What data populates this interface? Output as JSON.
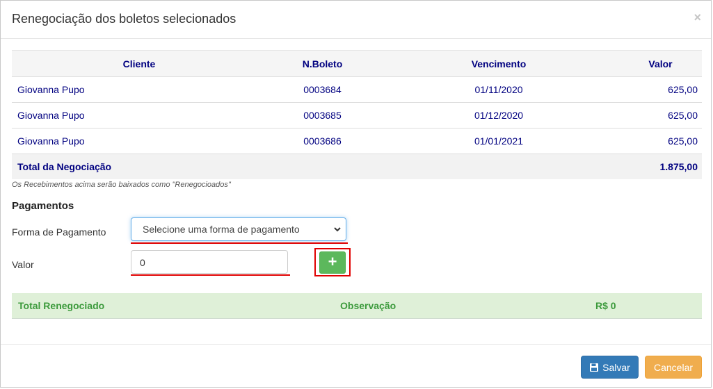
{
  "modal": {
    "title": "Renegociação dos boletos selecionados",
    "close": "×"
  },
  "table": {
    "headers": [
      "Cliente",
      "N.Boleto",
      "Vencimento",
      "Valor"
    ],
    "rows": [
      {
        "cliente": "Giovanna Pupo",
        "boleto": "0003684",
        "vencimento": "01/11/2020",
        "valor": "625,00"
      },
      {
        "cliente": "Giovanna Pupo",
        "boleto": "0003685",
        "vencimento": "01/12/2020",
        "valor": "625,00"
      },
      {
        "cliente": "Giovanna Pupo",
        "boleto": "0003686",
        "vencimento": "01/01/2021",
        "valor": "625,00"
      }
    ],
    "total_label": "Total da Negociação",
    "total_value": "1.875,00"
  },
  "note": "Os Recebimentos acima serão baixados como \"Renegocioados\"",
  "pagamentos": {
    "title": "Pagamentos",
    "forma_label": "Forma de Pagamento",
    "forma_value": "Selecione uma forma de pagamento",
    "valor_label": "Valor",
    "valor_value": "0",
    "add_label": "+"
  },
  "summary": {
    "total_label": "Total Renegociado",
    "obs_label": "Observação",
    "total_value": "R$ 0"
  },
  "footer": {
    "save_label": "Salvar",
    "cancel_label": "Cancelar"
  },
  "colors": {
    "primary": "#337ab7",
    "warning": "#f0ad4e",
    "success": "#5cb85c",
    "table_text": "#000080",
    "summary_text": "#3c9a3c",
    "annotation": "#e00000"
  },
  "icons": {
    "save": "floppy-disk-icon",
    "select_arrow": "chevron-down-icon"
  }
}
